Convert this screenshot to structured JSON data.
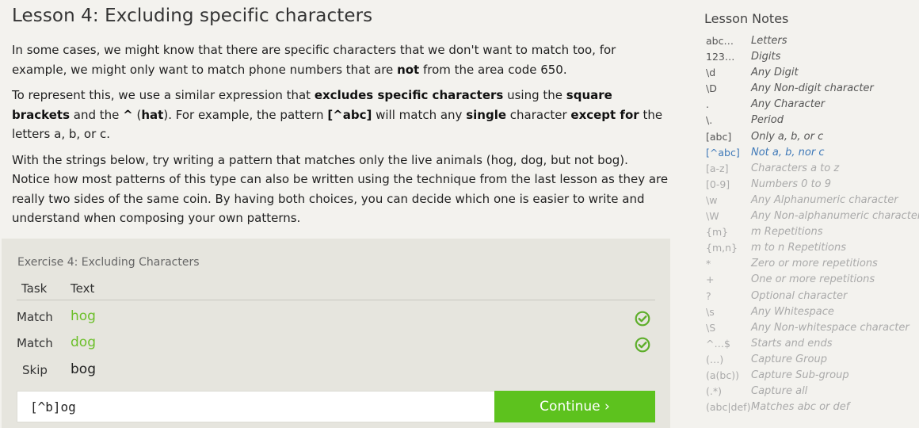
{
  "lesson": {
    "title": "Lesson 4: Excluding specific characters",
    "p1_a": "In some cases, we might know that there are specific characters that we don't want to match too, for example, we might only want to match phone numbers that are ",
    "p1_b": "not",
    "p1_c": " from the area code 650.",
    "p2_a": "To represent this, we use a similar expression that ",
    "p2_b": "excludes specific characters",
    "p2_c": " using the ",
    "p2_d": "square brackets",
    "p2_e": " and the ",
    "p2_f": "^",
    "p2_g": " (",
    "p2_h": "hat",
    "p2_i": "). For example, the pattern ",
    "p2_j": "[^abc]",
    "p2_k": " will match any ",
    "p2_l": "single",
    "p2_m": " character ",
    "p2_n": "except for",
    "p2_o": " the letters a, b, or c.",
    "p3": "With the strings below, try writing a pattern that matches only the live animals (hog, dog, but not bog). Notice how most patterns of this type can also be written using the technique from the last lesson as they are really two sides of the same coin. By having both choices, you can decide which one is easier to write and understand when composing your own patterns."
  },
  "exercise": {
    "title": "Exercise 4: Excluding Characters",
    "col_task": "Task",
    "col_text": "Text",
    "rows": [
      {
        "task": "Match",
        "text": "hog",
        "status": "matched"
      },
      {
        "task": "Match",
        "text": "dog",
        "status": "matched"
      },
      {
        "task": "Skip",
        "text": "bog",
        "status": "none"
      }
    ],
    "pattern_value": "[^b]og",
    "continue_label": "Continue ›",
    "accent_color": "#5dc21e",
    "check_icon": "check-circle-icon"
  },
  "notes": {
    "title": "Lesson Notes",
    "items": [
      {
        "code": "abc…",
        "desc": "Letters"
      },
      {
        "code": "123…",
        "desc": "Digits"
      },
      {
        "code": "\\d",
        "desc": "Any Digit"
      },
      {
        "code": "\\D",
        "desc": "Any Non-digit character"
      },
      {
        "code": ".",
        "desc": "Any Character"
      },
      {
        "code": "\\.",
        "desc": "Period"
      },
      {
        "code": "[abc]",
        "desc": "Only a, b, or c"
      },
      {
        "code": "[^abc]",
        "desc": "Not a, b, nor c"
      },
      {
        "code": "[a-z]",
        "desc": "Characters a to z"
      },
      {
        "code": "[0-9]",
        "desc": "Numbers 0 to 9"
      },
      {
        "code": "\\w",
        "desc": "Any Alphanumeric character"
      },
      {
        "code": "\\W",
        "desc": "Any Non-alphanumeric character"
      },
      {
        "code": "{m}",
        "desc": "m Repetitions"
      },
      {
        "code": "{m,n}",
        "desc": "m to n Repetitions"
      },
      {
        "code": "*",
        "desc": "Zero or more repetitions"
      },
      {
        "code": "+",
        "desc": "One or more repetitions"
      },
      {
        "code": "?",
        "desc": "Optional character"
      },
      {
        "code": "\\s",
        "desc": "Any Whitespace"
      },
      {
        "code": "\\S",
        "desc": "Any Non-whitespace character"
      },
      {
        "code": "^…$",
        "desc": "Starts and ends"
      },
      {
        "code": "(…)",
        "desc": "Capture Group"
      },
      {
        "code": "(a(bc))",
        "desc": "Capture Sub-group"
      },
      {
        "code": "(.*)",
        "desc": "Capture all"
      },
      {
        "code": "(abc|def)",
        "desc": "Matches abc or def"
      }
    ],
    "active_index": 7,
    "learned_count": 7,
    "active_color": "#3f79b8"
  }
}
